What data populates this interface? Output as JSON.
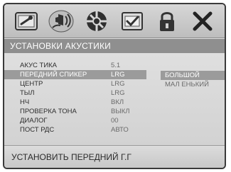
{
  "toolbar": {
    "icons": [
      {
        "name": "general-setup-icon"
      },
      {
        "name": "audio-setup-icon"
      },
      {
        "name": "video-setup-icon"
      },
      {
        "name": "preference-icon"
      },
      {
        "name": "password-lock-icon"
      },
      {
        "name": "exit-icon"
      }
    ]
  },
  "section_title": "УСТАНОВКИ АКУСТИКИ",
  "settings": [
    {
      "label": "АКУС ТИКА",
      "value": "5.1"
    },
    {
      "label": "ПЕРЕДНИЙ СПИКЕР",
      "value": "LRG"
    },
    {
      "label": "ЦЕНТР",
      "value": "LRG"
    },
    {
      "label": "ТЫЛ",
      "value": "LRG"
    },
    {
      "label": "НЧ",
      "value": "ВКЛ"
    },
    {
      "label": "ПРОВЕРКА ТОНА",
      "value": "ВЫКЛ"
    },
    {
      "label": "ДИАЛОГ",
      "value": "00"
    },
    {
      "label": "ПОСТ РДС",
      "value": "АВТО"
    }
  ],
  "options": [
    {
      "label": "БОЛЬШОЙ"
    },
    {
      "label": "МАЛ ЕНЬКИЙ"
    }
  ],
  "footer_text": "УСТАНОВИТЬ ПЕРЕДНИЙ Г.Г",
  "colors": {
    "header_bg": "#8f8f8f",
    "selected_bg": "#9b9b9b",
    "text": "#2e2e2e"
  }
}
